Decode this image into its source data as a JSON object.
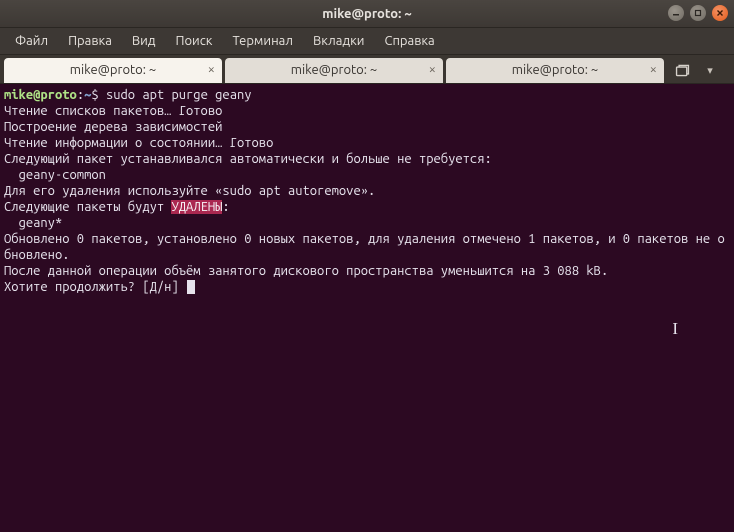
{
  "window": {
    "title": "mike@proto: ~"
  },
  "menubar": {
    "items": [
      "Файл",
      "Правка",
      "Вид",
      "Поиск",
      "Терминал",
      "Вкладки",
      "Справка"
    ]
  },
  "tabs": {
    "items": [
      {
        "label": "mike@proto: ~",
        "active": true
      },
      {
        "label": "mike@proto: ~",
        "active": false
      },
      {
        "label": "mike@proto: ~",
        "active": false
      }
    ]
  },
  "terminal": {
    "prompt_user": "mike@proto",
    "prompt_sep": ":",
    "prompt_path": "~",
    "prompt_dollar": "$ ",
    "command": "sudo apt purge geany",
    "lines": {
      "l1": "Чтение списков пакетов… Готово",
      "l2": "Построение дерева зависимостей",
      "l3": "Чтение информации о состоянии… Готово",
      "l4": "Следующий пакет устанавливался автоматически и больше не требуется:",
      "l5": "  geany-common",
      "l6": "Для его удаления используйте «sudo apt autoremove».",
      "l7_pre": "Следующие пакеты будут ",
      "l7_hl": "УДАЛЕНЫ",
      "l7_post": ":",
      "l8": "  geany*",
      "l9": "Обновлено 0 пакетов, установлено 0 новых пакетов, для удаления отмечено 1 пакетов, и 0 пакетов не обновлено.",
      "l10": "После данной операции объём занятого дискового пространства уменьшится на 3 088 kB.",
      "l11": "Хотите продолжить? [Д/н] "
    }
  }
}
